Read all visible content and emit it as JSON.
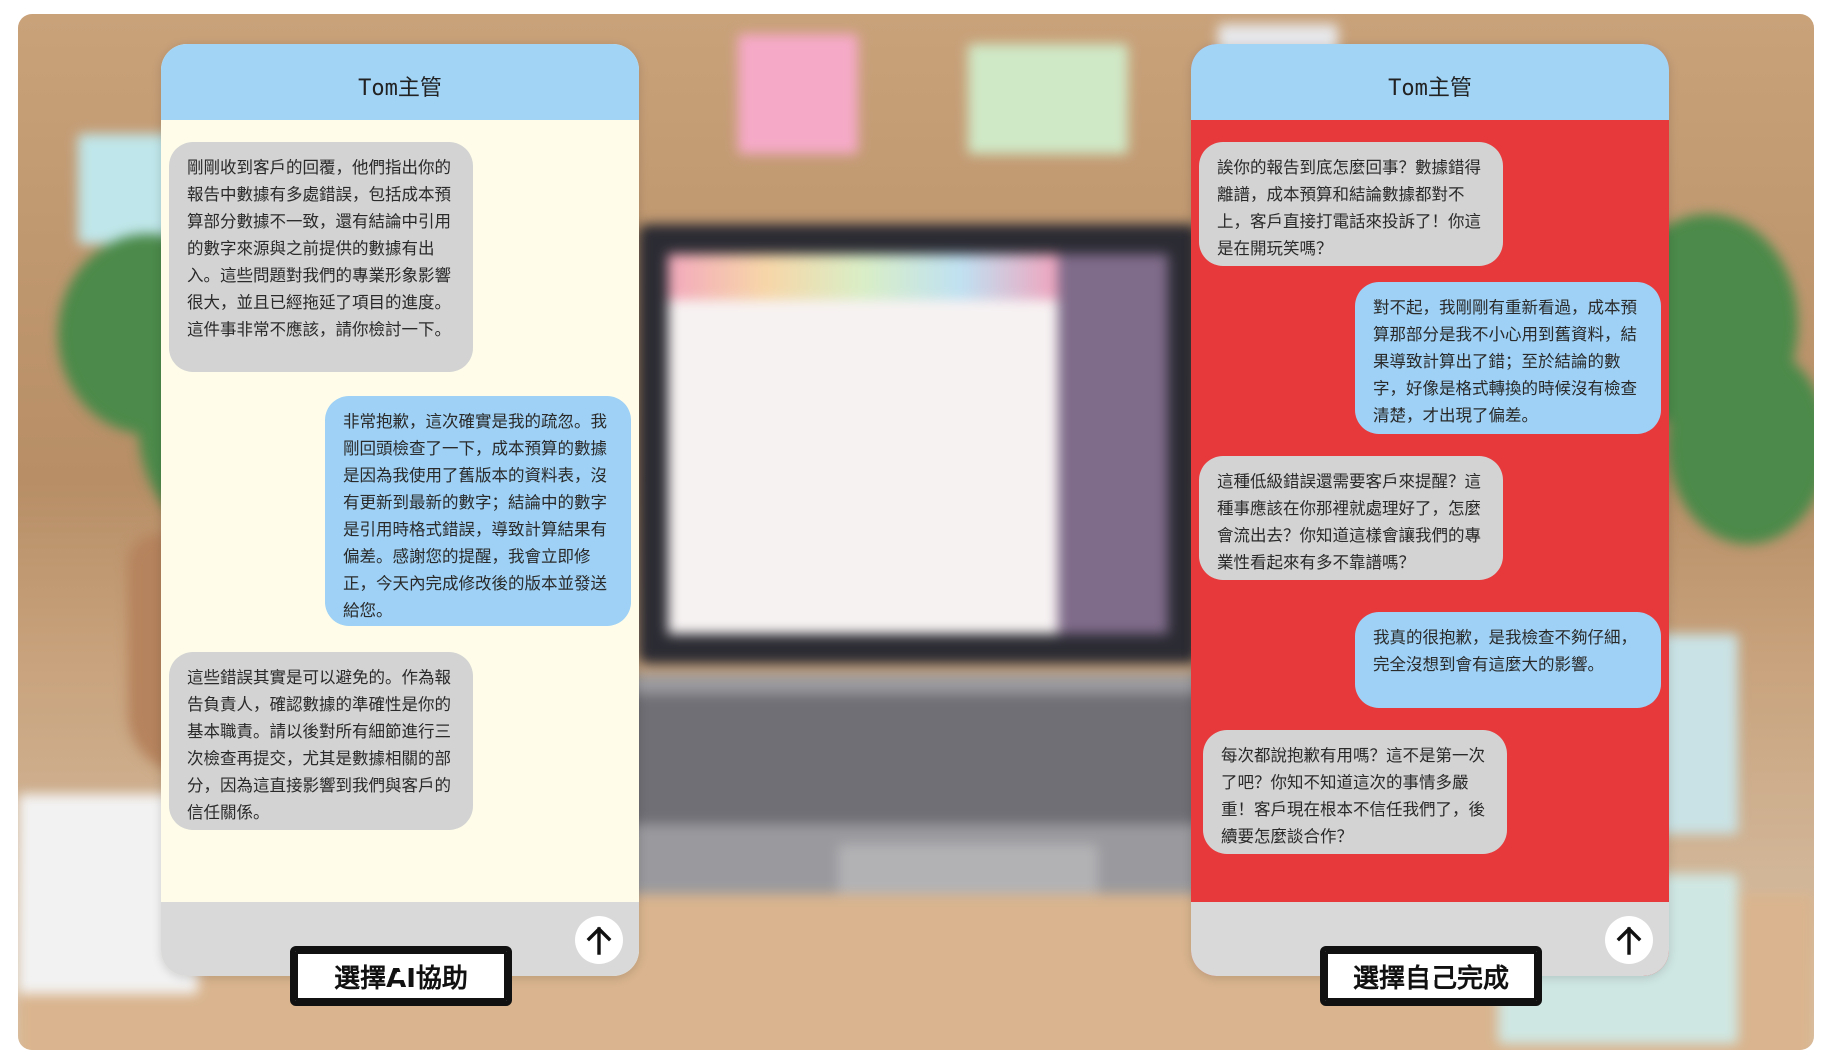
{
  "left_chat": {
    "title": "Tom主管",
    "messages": [
      {
        "side": "in",
        "text": "剛剛收到客戶的回覆，他們指出你的報告中數據有多處錯誤，包括成本預算部分數據不一致，還有結論中引用的數字來源與之前提供的數據有出入。這些問題對我們的專業形象影響很大，並且已經拖延了項目的進度。這件事非常不應該，請你檢討一下。"
      },
      {
        "side": "out",
        "text": "非常抱歉，這次確實是我的疏忽。我剛回頭檢查了一下，成本預算的數據是因為我使用了舊版本的資料表，沒有更新到最新的數字；結論中的數字是引用時格式錯誤，導致計算結果有偏差。感謝您的提醒，我會立即修正，今天內完成修改後的版本並發送給您。"
      },
      {
        "side": "in",
        "text": "這些錯誤其實是可以避免的。作為報告負責人，確認數據的準確性是你的基本職責。請以後對所有細節進行三次檢查再提交，尤其是數據相關的部分，因為這直接影響到我們與客戶的信任關係。"
      }
    ],
    "choice_label": "選擇AI協助",
    "send_icon": "arrow-up-icon"
  },
  "right_chat": {
    "title": "Tom主管",
    "messages": [
      {
        "side": "in",
        "text": "誒你的報告到底怎麼回事？數據錯得離譜，成本預算和結論數據都對不上，客戶直接打電話來投訴了！你這是在開玩笑嗎？"
      },
      {
        "side": "out",
        "text": "對不起，我剛剛有重新看過，成本預算那部分是我不小心用到舊資料，結果導致計算出了錯；至於結論的數字，好像是格式轉換的時候沒有檢查清楚，才出現了偏差。"
      },
      {
        "side": "in",
        "text": "這種低級錯誤還需要客戶來提醒？這種事應該在你那裡就處理好了，怎麼會流出去？你知道這樣會讓我們的專業性看起來有多不靠譜嗎？"
      },
      {
        "side": "out",
        "text": "我真的很抱歉，是我檢查不夠仔細，完全沒想到會有這麼大的影響。"
      },
      {
        "side": "in",
        "text": "每次都說抱歉有用嗎？這不是第一次了吧？你知不知道這次的事情多嚴重！客戶現在根本不信任我們了，後續要怎麼談合作？"
      }
    ],
    "choice_label": "選擇自己完成",
    "send_icon": "arrow-up-icon"
  },
  "colors": {
    "header_blue": "#a2d4f6",
    "left_bg": "#fffde9",
    "right_bg": "#e7393b",
    "incoming_bubble": "#d3d3d3",
    "outgoing_bubble": "#9ed1f5",
    "footer_gray": "#d9d9d9"
  }
}
